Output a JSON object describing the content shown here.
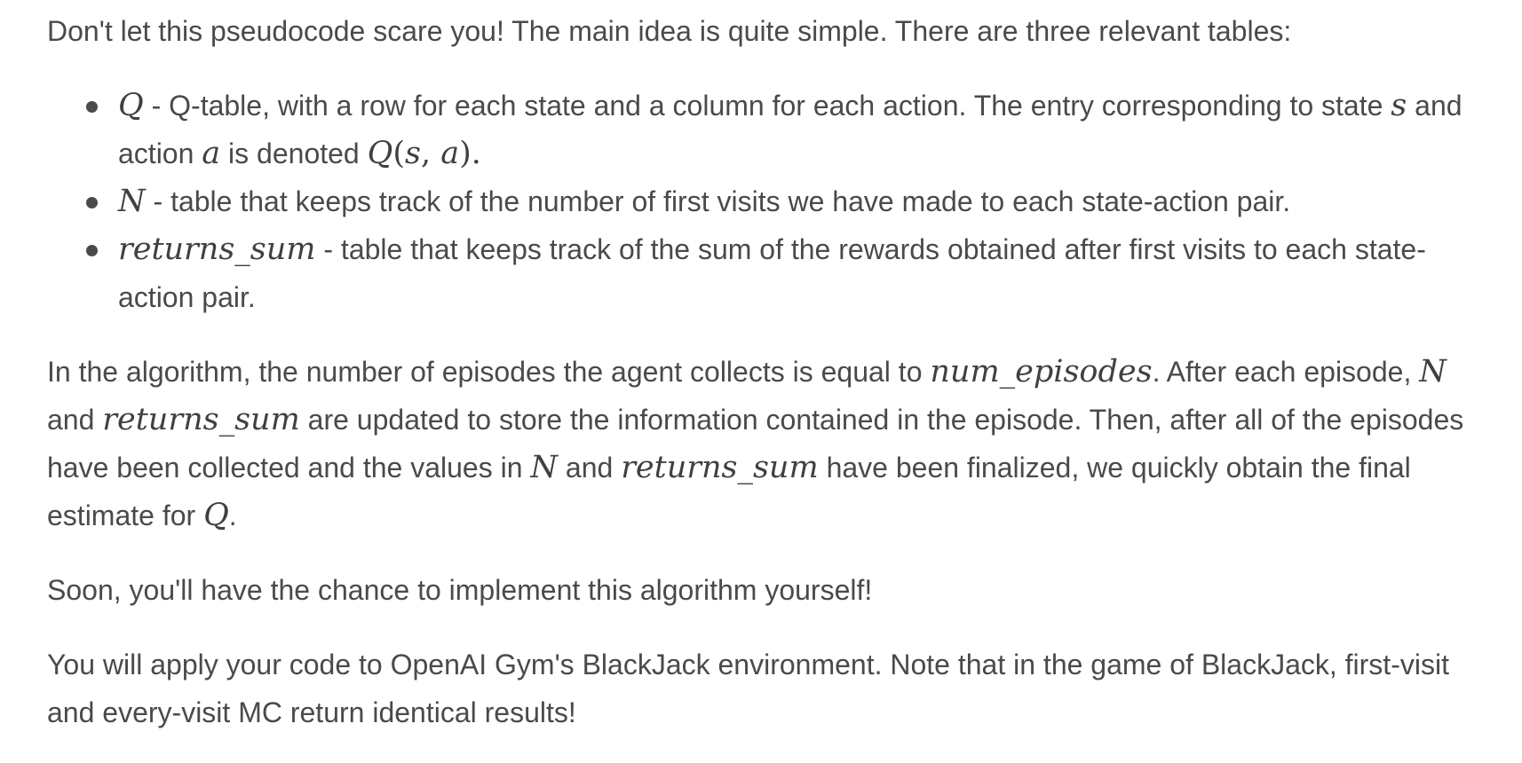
{
  "intro": {
    "text": "Don't let this pseudocode scare you! The main idea is quite simple. There are three relevant tables:"
  },
  "bullets": [
    {
      "symbol": "Q",
      "text_a": " - Q-table, with a row for each state and a column for each action. The entry corresponding to state ",
      "s": "s",
      "text_b": " and action ",
      "a": "a",
      "text_c": " is denoted ",
      "expr_Q": "Q",
      "expr_open": "(",
      "expr_s": "s",
      "expr_comma": ", ",
      "expr_a": "a",
      "expr_close": ").",
      "text_d": ""
    },
    {
      "symbol": "N",
      "text_a": " - table that keeps track of the number of first visits we have made to each state-action pair."
    },
    {
      "symbol": "returns_sum",
      "text_a": " - table that keeps track of the sum of the rewards obtained after first visits to each state-action pair."
    }
  ],
  "para2": {
    "t1": "In the algorithm, the number of episodes the agent collects is equal to ",
    "m1": "num_episodes",
    "t2": ". After each episode, ",
    "m2": "N",
    "t3": " and ",
    "m3": "returns_sum",
    "t4": " are updated to store the information contained in the episode. Then, after all of the episodes have been collected and the values in ",
    "m4": "N",
    "t5": " and ",
    "m5": "returns_sum",
    "t6": " have been finalized, we quickly obtain the final estimate for ",
    "m6": "Q",
    "t7": "."
  },
  "para3": {
    "text": "Soon, you'll have the chance to implement this algorithm yourself!"
  },
  "para4": {
    "text": "You will apply your code to OpenAI Gym's BlackJack environment. Note that in the game of BlackJack, first-visit and every-visit MC return identical results!"
  }
}
